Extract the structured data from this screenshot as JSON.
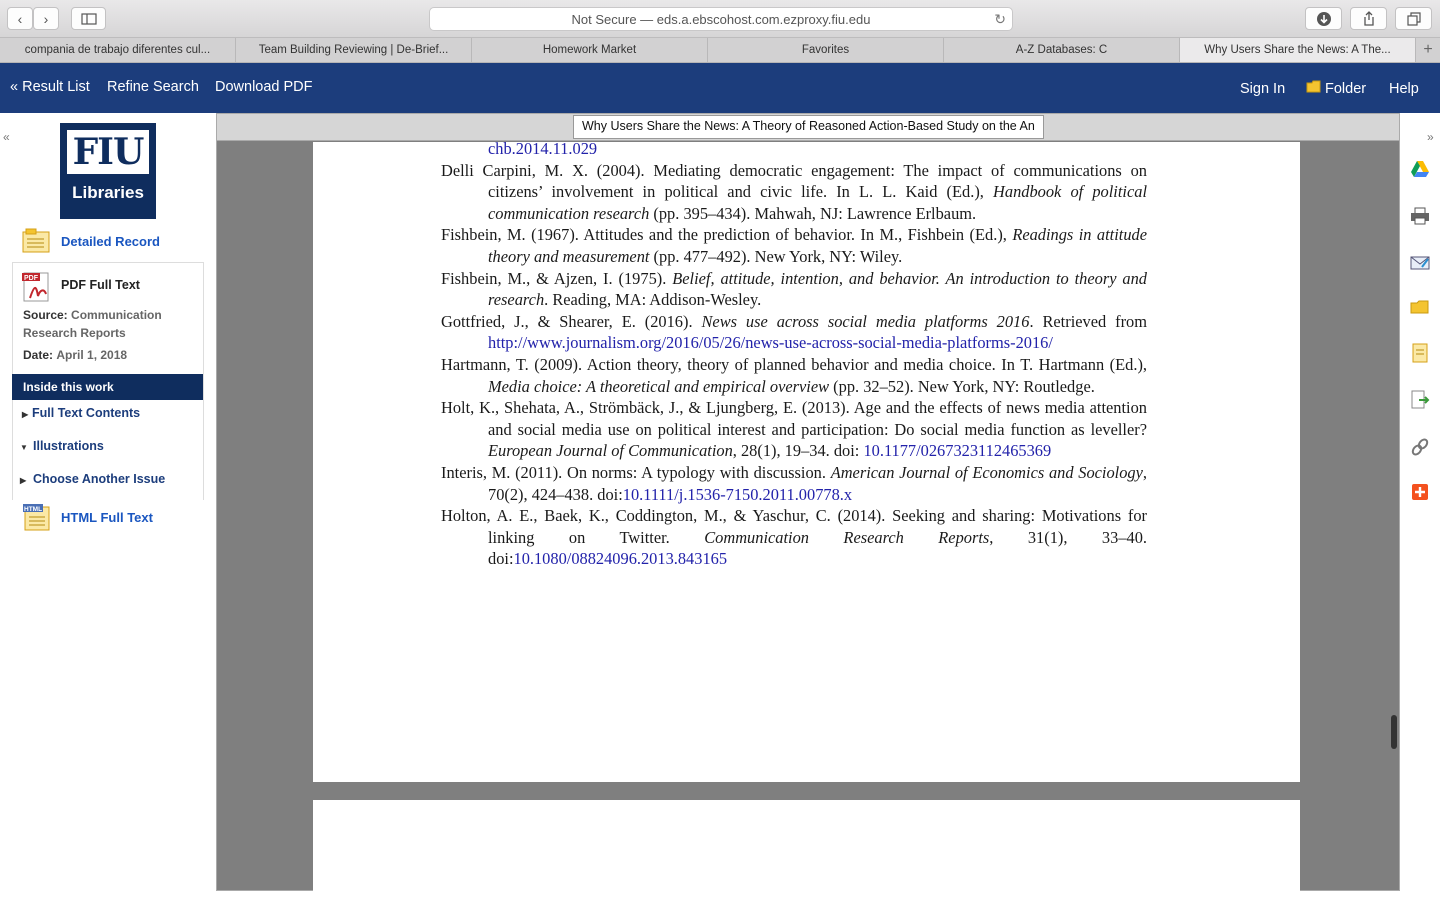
{
  "browser": {
    "url_text": "Not Secure — eds.a.ebscohost.com.ezproxy.fiu.edu",
    "tabs": [
      {
        "label": "compania de trabajo diferentes cul..."
      },
      {
        "label": "Team Building Reviewing | De-Brief..."
      },
      {
        "label": "Homework Market"
      },
      {
        "label": "Favorites"
      },
      {
        "label": "A-Z Databases: C"
      },
      {
        "label": "Why Users Share the News: A The..."
      }
    ]
  },
  "header": {
    "result_list": "« Result List",
    "refine_search": "Refine Search",
    "download_pdf": "Download PDF",
    "sign_in": "Sign In",
    "folder": "Folder",
    "help": "Help"
  },
  "sidebar": {
    "logo_top": "FIU",
    "logo_bottom": "Libraries",
    "detailed_record": "Detailed Record",
    "pdf_full_text": "PDF Full Text",
    "source_label": "Source:",
    "source_value_1": "Communication",
    "source_value_2": "Research Reports",
    "date_label": "Date:",
    "date_value": "April 1, 2018",
    "inside_this_work": "Inside this work",
    "full_text_contents": "Full Text Contents",
    "illustrations": "Illustrations",
    "choose_another_issue": "Choose Another Issue",
    "html_full_text": "HTML Full Text"
  },
  "viewer": {
    "title": "Why Users Share the News: A Theory of Reasoned Action-Based Study on the An",
    "top_fragment": "chb.2014.11.029",
    "references": [
      {
        "pre": "Delli Carpini, M. X. (2004). Mediating democratic engagement: The impact of communications on citizens’ involvement in political and civic life. In L. L. Kaid (Ed.), ",
        "ital": "Handbook of political communication research",
        "post": " (pp. 395–434). Mahwah, NJ: Lawrence Erlbaum.",
        "link": ""
      },
      {
        "pre": "Fishbein, M. (1967). Attitudes and the prediction of behavior. In M., Fishbein (Ed.), ",
        "ital": "Readings in attitude theory and measurement",
        "post": " (pp. 477–492). New York, NY: Wiley.",
        "link": ""
      },
      {
        "pre": "Fishbein, M., & Ajzen, I. (1975). ",
        "ital": "Belief, attitude, intention, and behavior. An introduction to theory and research",
        "post": ". Reading, MA: Addison-Wesley.",
        "link": ""
      },
      {
        "pre": "Gottfried, J., & Shearer, E. (2016). ",
        "ital": "News use across social media platforms 2016",
        "post": ". Retrieved from ",
        "link": "http://www.journalism.org/2016/05/26/news-use-across-social-media-platforms-2016/"
      },
      {
        "pre": "Hartmann, T. (2009). Action theory, theory of planned behavior and media choice. In T. Hartmann (Ed.), ",
        "ital": "Media choice: A theoretical and empirical overview",
        "post": " (pp. 32–52). New York, NY: Routledge.",
        "link": ""
      },
      {
        "pre": "Holt, K., Shehata, A., Strömbäck, J., & Ljungberg, E. (2013). Age and the effects of news media attention and social media use on political interest and participation: Do social media function as leveller? ",
        "ital": "European Journal of Communication",
        "post": ", 28(1), 19–34. doi: ",
        "link": "10.1177/0267323112465369"
      },
      {
        "pre": "Interis, M. (2011). On norms: A typology with discussion. ",
        "ital": "American Journal of Economics and Sociology",
        "post": ", 70(2), 424–438. doi:",
        "link": "10.1111/j.1536-7150.2011.00778.x"
      },
      {
        "pre": "Holton, A. E., Baek, K., Coddington, M., & Yaschur, C. (2014). Seeking and sharing: Motivations for linking on Twitter. ",
        "ital": "Communication Research Reports",
        "post": ", 31(1), 33–40. doi:",
        "link": "10.1080/08824096.2013.843165"
      }
    ]
  },
  "colors": {
    "header_bg": "#1c3d7c",
    "link_blue": "#1a56c0",
    "navy": "#0f2d5e"
  }
}
